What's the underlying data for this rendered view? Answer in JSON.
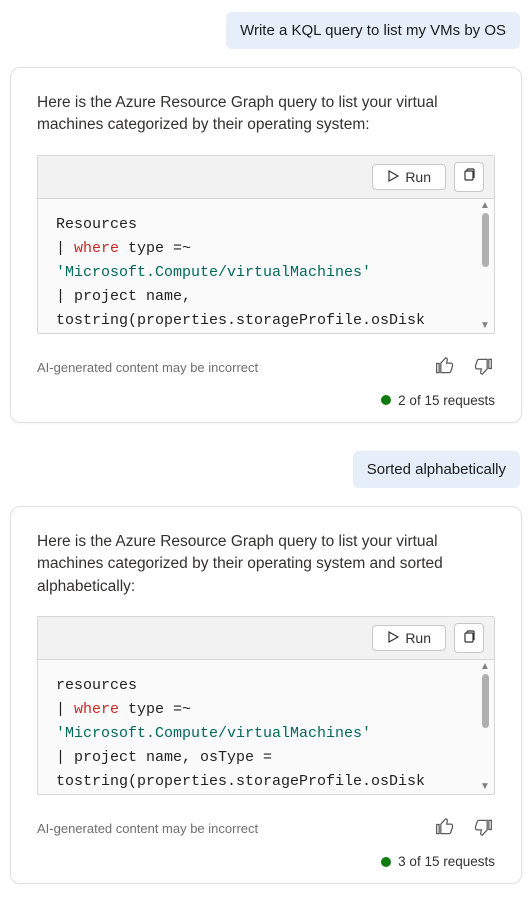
{
  "labels": {
    "run": "Run",
    "disclaimer": "AI-generated content may be incorrect"
  },
  "colors": {
    "accent_green": "#107c10",
    "keyword": "#c62828",
    "string": "#00695c"
  },
  "conversation": [
    {
      "role": "user",
      "text": "Write a KQL query to list my VMs by OS"
    },
    {
      "role": "assistant",
      "intro": "Here is the Azure Resource Graph query to list your virtual machines categorized by their operating system:",
      "code": {
        "line1": "Resources",
        "line2_pipe": "| ",
        "line2_kw": "where",
        "line2_rest": " type =~",
        "line3_str": "'Microsoft.Compute/virtualMachines'",
        "line4": "| project name,",
        "line5_cut": "tostring(properties.storageProfile.osDisk"
      },
      "usage": "2 of 15 requests"
    },
    {
      "role": "user",
      "text": "Sorted alphabetically"
    },
    {
      "role": "assistant",
      "intro": "Here is the Azure Resource Graph query to list your virtual machines categorized by their operating system and sorted alphabetically:",
      "code": {
        "line1": "resources",
        "line2_pipe": "| ",
        "line2_kw": "where",
        "line2_rest": " type =~",
        "line3_str": "'Microsoft.Compute/virtualMachines'",
        "line4": "| project name, osType =",
        "line5_cut": "tostring(properties.storageProfile.osDisk"
      },
      "usage": "3 of 15 requests"
    }
  ]
}
